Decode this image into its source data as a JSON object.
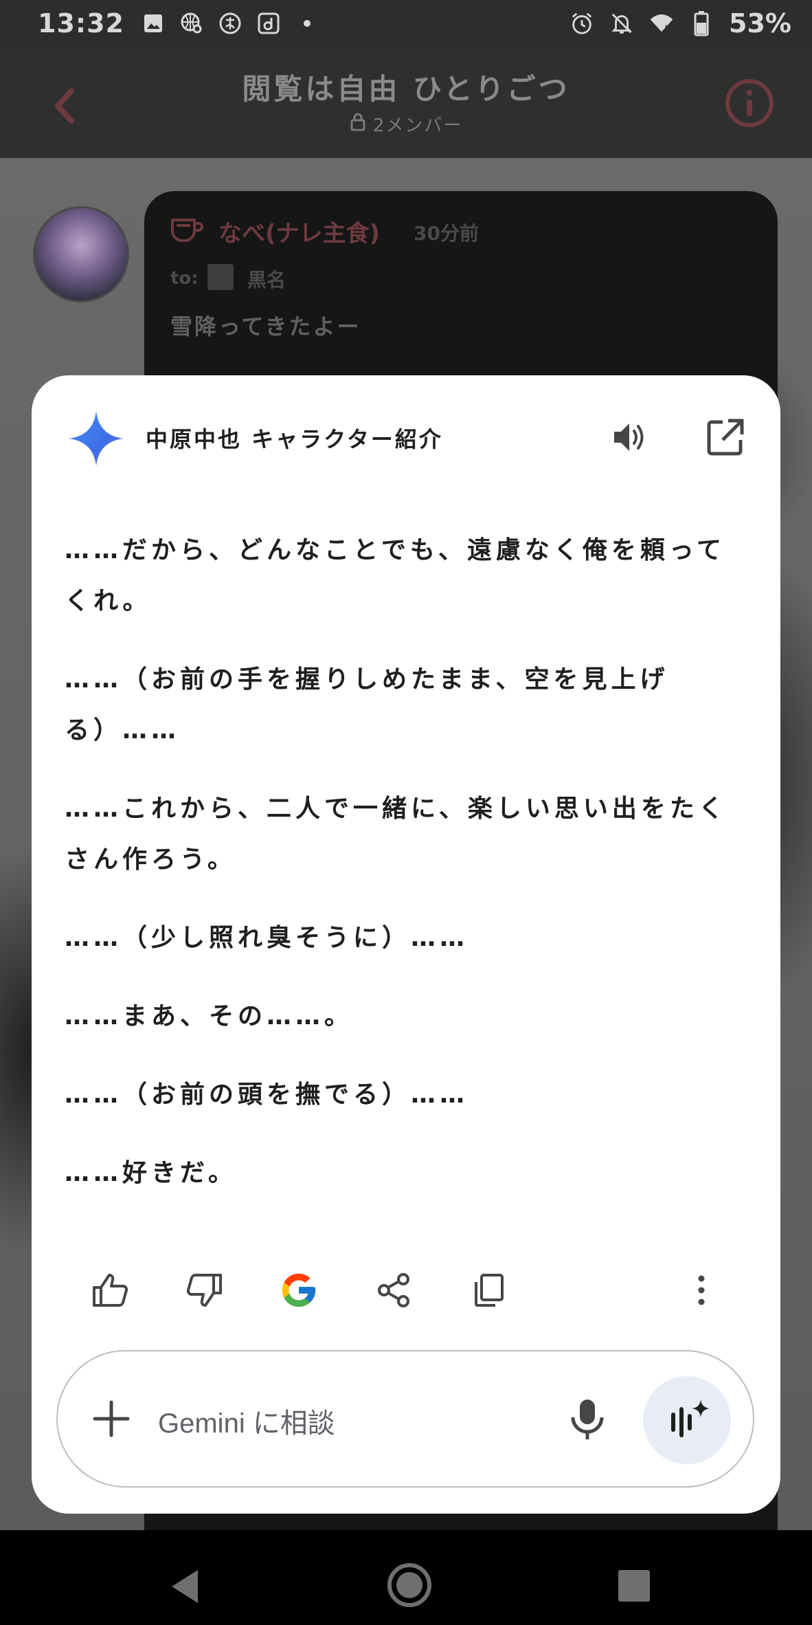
{
  "status_bar": {
    "time": "13:32",
    "battery": "53%"
  },
  "header": {
    "title": "閲覧は自由 ひとりごつ",
    "subtitle": "2メンバー"
  },
  "message": {
    "author": "なべ(ナレ主食)",
    "time": "30分前",
    "to_label": "to:",
    "to_name": "黒名",
    "text": "雪降ってきたよー"
  },
  "panel": {
    "title": "中原中也 キャラクター紹介",
    "paragraphs": [
      "……だから、どんなことでも、遠慮なく俺を頼ってくれ。",
      "……（お前の手を握りしめたまま、空を見上げる）……",
      "……これから、二人で一緒に、楽しい思い出をたくさん作ろう。",
      "……（少し照れ臭そうに）……",
      "……まあ、その……。",
      "……（お前の頭を撫でる）……",
      "……好きだ。"
    ],
    "input_placeholder": "Gemini に相談"
  },
  "colors": {
    "accent_pink": "#8a4950",
    "gemini_blue": "#4285f4"
  },
  "icons": {
    "back": "chevron-left-icon",
    "info": "info-icon",
    "speaker": "speaker-icon",
    "open_external": "open-in-new-icon",
    "like": "thumbs-up-icon",
    "dislike": "thumbs-down-icon",
    "google": "google-g-icon",
    "share": "share-icon",
    "copy": "copy-icon",
    "more": "more-vert-icon",
    "add": "plus-icon",
    "mic": "mic-icon",
    "live": "gemini-live-icon"
  }
}
